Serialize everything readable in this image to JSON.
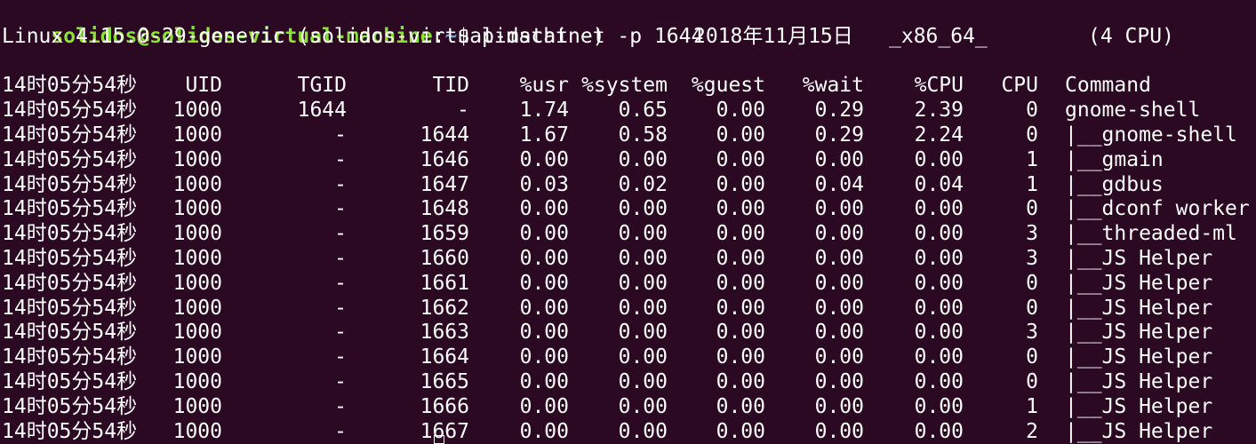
{
  "prompt": {
    "user_host": "solidos@solidos-virtual-machine",
    "separator": ":",
    "path": "~",
    "symbol": "$ ",
    "command": "pidstat -t -p 1644"
  },
  "sysinfo": {
    "kernel": "Linux 4.15.0-29-generic (solidos-virtual-machine)",
    "date": "2018年11月15日",
    "arch": "_x86_64_",
    "cpus": "(4 CPU)"
  },
  "table": {
    "headers": {
      "time": "14时05分54秒",
      "uid": "UID",
      "tgid": "TGID",
      "tid": "TID",
      "usr": "%usr",
      "system": "%system",
      "guest": "%guest",
      "wait": "%wait",
      "cpu_pct": "%CPU",
      "cpu": "CPU",
      "command": "Command"
    },
    "rows": [
      {
        "time": "14时05分54秒",
        "uid": "1000",
        "tgid": "1644",
        "tid": "-",
        "usr": "1.74",
        "system": "0.65",
        "guest": "0.00",
        "wait": "0.29",
        "cpu_pct": "2.39",
        "cpu": "0",
        "command": "gnome-shell"
      },
      {
        "time": "14时05分54秒",
        "uid": "1000",
        "tgid": "-",
        "tid": "1644",
        "usr": "1.67",
        "system": "0.58",
        "guest": "0.00",
        "wait": "0.29",
        "cpu_pct": "2.24",
        "cpu": "0",
        "command": "|__gnome-shell"
      },
      {
        "time": "14时05分54秒",
        "uid": "1000",
        "tgid": "-",
        "tid": "1646",
        "usr": "0.00",
        "system": "0.00",
        "guest": "0.00",
        "wait": "0.00",
        "cpu_pct": "0.00",
        "cpu": "1",
        "command": "|__gmain"
      },
      {
        "time": "14时05分54秒",
        "uid": "1000",
        "tgid": "-",
        "tid": "1647",
        "usr": "0.03",
        "system": "0.02",
        "guest": "0.00",
        "wait": "0.04",
        "cpu_pct": "0.04",
        "cpu": "1",
        "command": "|__gdbus"
      },
      {
        "time": "14时05分54秒",
        "uid": "1000",
        "tgid": "-",
        "tid": "1648",
        "usr": "0.00",
        "system": "0.00",
        "guest": "0.00",
        "wait": "0.00",
        "cpu_pct": "0.00",
        "cpu": "0",
        "command": "|__dconf worker"
      },
      {
        "time": "14时05分54秒",
        "uid": "1000",
        "tgid": "-",
        "tid": "1659",
        "usr": "0.00",
        "system": "0.00",
        "guest": "0.00",
        "wait": "0.00",
        "cpu_pct": "0.00",
        "cpu": "3",
        "command": "|__threaded-ml"
      },
      {
        "time": "14时05分54秒",
        "uid": "1000",
        "tgid": "-",
        "tid": "1660",
        "usr": "0.00",
        "system": "0.00",
        "guest": "0.00",
        "wait": "0.00",
        "cpu_pct": "0.00",
        "cpu": "3",
        "command": "|__JS Helper"
      },
      {
        "time": "14时05分54秒",
        "uid": "1000",
        "tgid": "-",
        "tid": "1661",
        "usr": "0.00",
        "system": "0.00",
        "guest": "0.00",
        "wait": "0.00",
        "cpu_pct": "0.00",
        "cpu": "0",
        "command": "|__JS Helper"
      },
      {
        "time": "14时05分54秒",
        "uid": "1000",
        "tgid": "-",
        "tid": "1662",
        "usr": "0.00",
        "system": "0.00",
        "guest": "0.00",
        "wait": "0.00",
        "cpu_pct": "0.00",
        "cpu": "0",
        "command": "|__JS Helper"
      },
      {
        "time": "14时05分54秒",
        "uid": "1000",
        "tgid": "-",
        "tid": "1663",
        "usr": "0.00",
        "system": "0.00",
        "guest": "0.00",
        "wait": "0.00",
        "cpu_pct": "0.00",
        "cpu": "3",
        "command": "|__JS Helper"
      },
      {
        "time": "14时05分54秒",
        "uid": "1000",
        "tgid": "-",
        "tid": "1664",
        "usr": "0.00",
        "system": "0.00",
        "guest": "0.00",
        "wait": "0.00",
        "cpu_pct": "0.00",
        "cpu": "0",
        "command": "|__JS Helper"
      },
      {
        "time": "14时05分54秒",
        "uid": "1000",
        "tgid": "-",
        "tid": "1665",
        "usr": "0.00",
        "system": "0.00",
        "guest": "0.00",
        "wait": "0.00",
        "cpu_pct": "0.00",
        "cpu": "0",
        "command": "|__JS Helper"
      },
      {
        "time": "14时05分54秒",
        "uid": "1000",
        "tgid": "-",
        "tid": "1666",
        "usr": "0.00",
        "system": "0.00",
        "guest": "0.00",
        "wait": "0.00",
        "cpu_pct": "0.00",
        "cpu": "1",
        "command": "|__JS Helper"
      },
      {
        "time": "14时05分54秒",
        "uid": "1000",
        "tgid": "-",
        "tid": "1667",
        "usr": "0.00",
        "system": "0.00",
        "guest": "0.00",
        "wait": "0.00",
        "cpu_pct": "0.00",
        "cpu": "2",
        "command": "|__JS Helper"
      }
    ]
  },
  "colors": {
    "background": "#2c0922",
    "text": "#ffffff",
    "prompt_user": "#8ae234",
    "prompt_path": "#729fcf"
  }
}
